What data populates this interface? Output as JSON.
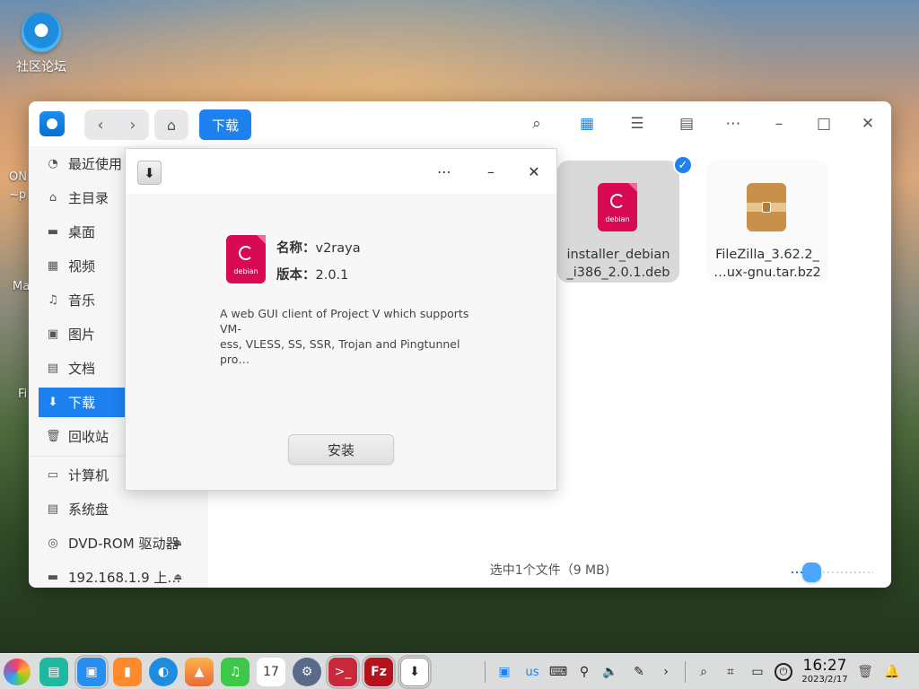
{
  "desktop": {
    "icon_label": "社区论坛",
    "side_labels": [
      "ON",
      "~p",
      "Ma",
      "Fi"
    ]
  },
  "file_manager": {
    "breadcrumb": "下载",
    "sidebar": [
      {
        "label": "最近使用",
        "icon": "clock-icon"
      },
      {
        "label": "主目录",
        "icon": "home-icon"
      },
      {
        "label": "桌面",
        "icon": "desktop-icon"
      },
      {
        "label": "视频",
        "icon": "video-icon"
      },
      {
        "label": "音乐",
        "icon": "music-icon"
      },
      {
        "label": "图片",
        "icon": "picture-icon"
      },
      {
        "label": "文档",
        "icon": "document-icon"
      },
      {
        "label": "下载",
        "icon": "download-icon"
      },
      {
        "label": "回收站",
        "icon": "trash-icon"
      },
      {
        "label": "计算机",
        "icon": "computer-icon"
      },
      {
        "label": "系统盘",
        "icon": "disk-icon"
      },
      {
        "label": "DVD-ROM 驱动器",
        "icon": "dvd-icon"
      },
      {
        "label": "192.168.1.9 上…",
        "icon": "network-share-icon"
      }
    ],
    "files": [
      {
        "name_line1": "installer_debian",
        "name_line2": "_i386_2.0.1.deb",
        "selected": true,
        "icon_label": "debian"
      },
      {
        "name_line1": "FileZilla_3.62.2_",
        "name_line2": "…ux-gnu.tar.bz2",
        "selected": false
      }
    ],
    "status": "选中1个文件（9 MB)",
    "icon_size_level": 0.25
  },
  "installer": {
    "name_label": "名称：",
    "name_value": "v2raya",
    "version_label": "版本：",
    "version_value": "2.0.1",
    "icon_label": "debian",
    "description_lines": [
      "A web GUI client of Project V which supports VM-",
      "ess, VLESS, SS, SSR, Trojan and Pingtunnel",
      "pro…"
    ],
    "install_label": "安装"
  },
  "dock": {
    "keyboard_layout": "us",
    "time": "16:27",
    "date": "2023/2/17",
    "calendar_day": "17"
  },
  "colors": {
    "accent": "#1d81f0",
    "debian": "#d70a53",
    "archive": "#c8904a"
  }
}
